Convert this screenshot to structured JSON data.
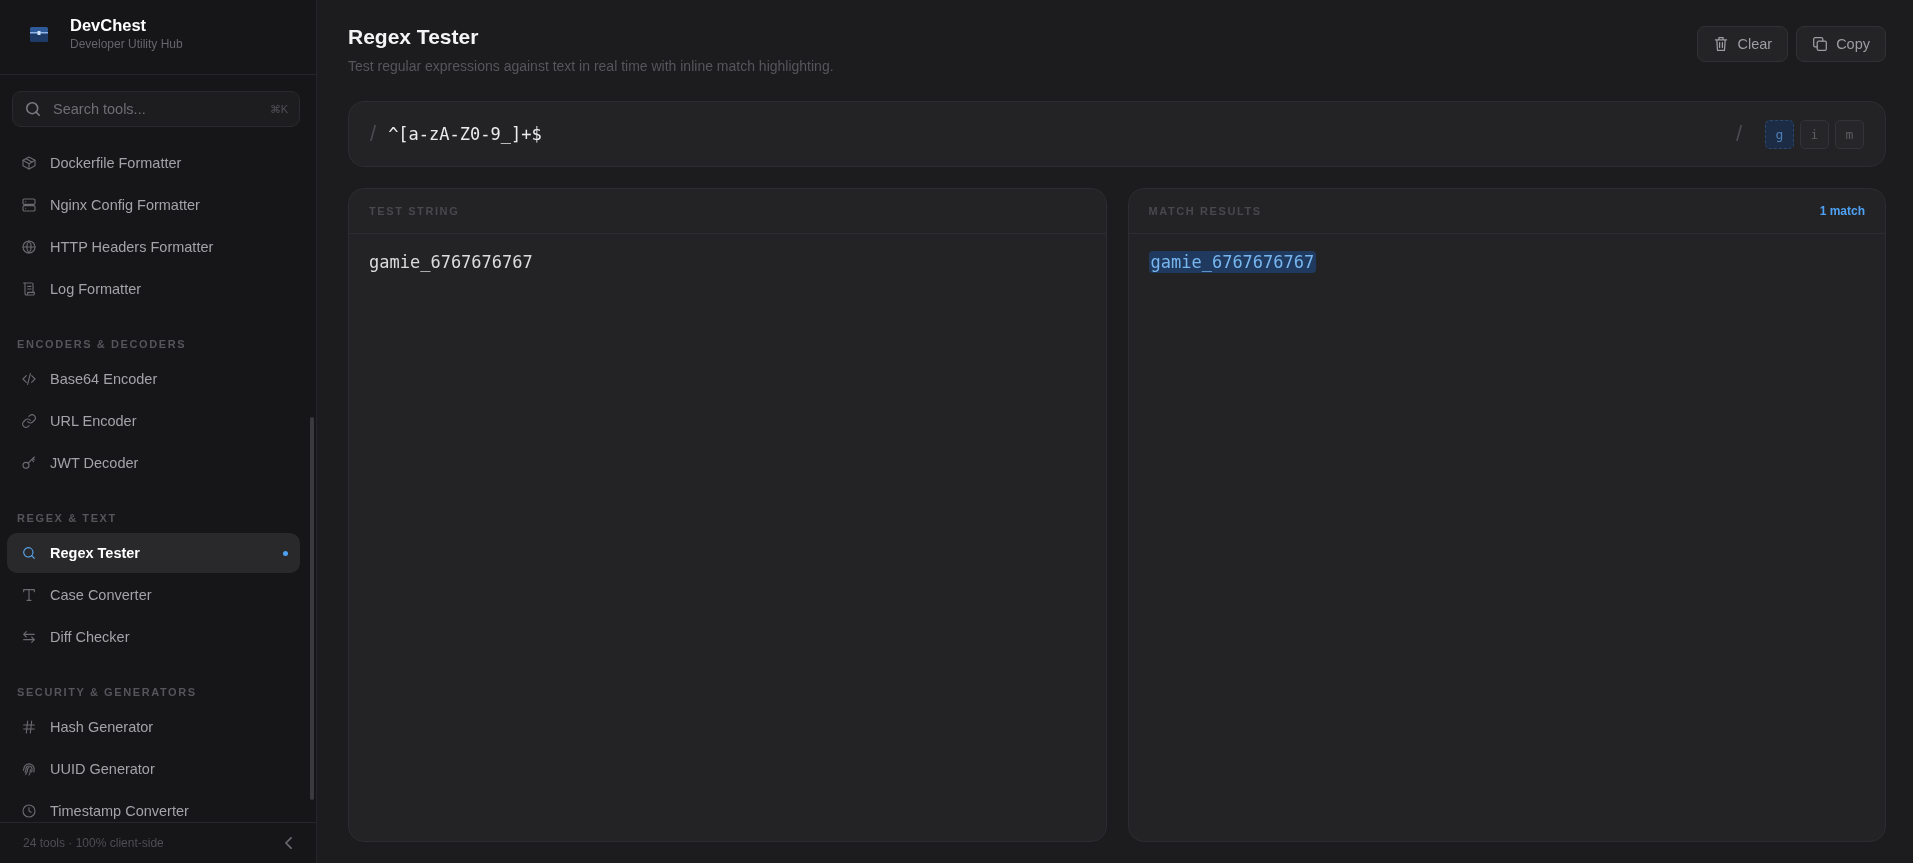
{
  "sidebar": {
    "brand": {
      "title": "DevChest",
      "subtitle": "Developer Utility Hub"
    },
    "search": {
      "placeholder": "Search tools...",
      "shortcut": "⌘K"
    },
    "sections": [
      {
        "items": [
          {
            "label": "Dockerfile Formatter",
            "selected": false
          },
          {
            "label": "Nginx Config Formatter",
            "selected": false
          },
          {
            "label": "HTTP Headers Formatter",
            "selected": false
          },
          {
            "label": "Log Formatter",
            "selected": false
          }
        ]
      },
      {
        "heading": "ENCODERS & DECODERS",
        "items": [
          {
            "label": "Base64 Encoder",
            "selected": false
          },
          {
            "label": "URL Encoder",
            "selected": false
          },
          {
            "label": "JWT Decoder",
            "selected": false
          }
        ]
      },
      {
        "heading": "REGEX & TEXT",
        "items": [
          {
            "label": "Regex Tester",
            "selected": true
          },
          {
            "label": "Case Converter",
            "selected": false
          },
          {
            "label": "Diff Checker",
            "selected": false
          }
        ]
      },
      {
        "heading": "SECURITY & GENERATORS",
        "items": [
          {
            "label": "Hash Generator",
            "selected": false
          },
          {
            "label": "UUID Generator",
            "selected": false
          },
          {
            "label": "Timestamp Converter",
            "selected": false
          }
        ]
      }
    ],
    "footer": {
      "text": "24 tools · 100% client-side"
    }
  },
  "header": {
    "title": "Regex Tester",
    "description": "Test regular expressions against text in real time with inline match highlighting.",
    "actions": [
      {
        "label": "Clear"
      },
      {
        "label": "Copy"
      }
    ]
  },
  "regex": {
    "open_delimiter": "/",
    "pattern": "^[a-zA-Z0-9_]+$",
    "close_delimiter": "/",
    "flags": [
      {
        "label": "g",
        "selected": true
      },
      {
        "label": "i",
        "selected": false
      },
      {
        "label": "m",
        "selected": false
      }
    ]
  },
  "test_string": {
    "heading": "TEST STRING",
    "value": "gamie_6767676767"
  },
  "results": {
    "heading": "MATCH RESULTS",
    "count": "1 match",
    "segments": [
      {
        "text": "gamie_6767676767",
        "match": true
      }
    ]
  }
}
